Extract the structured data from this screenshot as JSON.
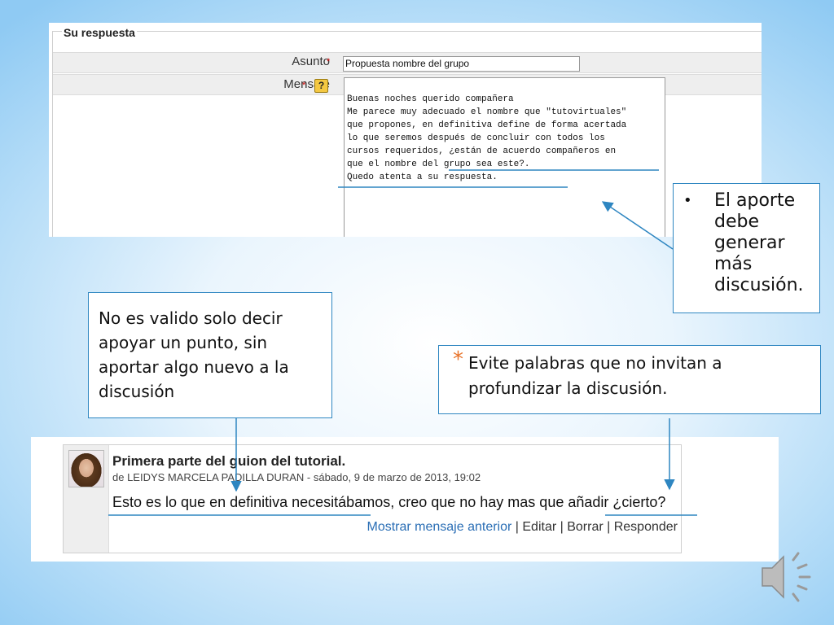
{
  "form": {
    "legend": "Su respuesta",
    "asunto_label": "Asunto",
    "mensaje_label": "Mensaje",
    "required_mark": "*",
    "help_icon": "?",
    "asunto_value": "Propuesta nombre del grupo",
    "mensaje_lines": [
      "Buenas noches querido compañera",
      "",
      "Me parece muy adecuado el nombre que \"tutovirtuales\"",
      "que propones, en definitiva define de forma acertada",
      "lo que seremos después de concluir con todos los",
      "cursos requeridos, ¿están de acuerdo compañeros en",
      "que el nombre del grupo sea este?.",
      "",
      "Quedo atenta a su respuesta."
    ]
  },
  "callouts": {
    "aporte_bullet": "•",
    "aporte_text": "El aporte debe generar más discusión.",
    "valido_text": "No es valido solo decir apoyar un punto, sin aportar algo nuevo a la discusión",
    "evite_star": "*",
    "evite_text": "Evite palabras  que no invitan a profundizar la discusión."
  },
  "forum": {
    "title": "Primera parte del guion del tutorial.",
    "meta": "de LEIDYS MARCELA PADILLA DURAN - sábado, 9 de marzo de 2013, 19:02",
    "body": "Esto es lo que en definitiva necesitábamos, creo que no hay mas que añadir ¿cierto?",
    "action_show_prev": "Mostrar mensaje anterior",
    "action_sep": " | ",
    "action_edit": "Editar",
    "action_delete": "Borrar",
    "action_reply": "Responder"
  },
  "colors": {
    "callout_border": "#2e86c1",
    "arrow": "#2e86c1",
    "star": "#e8732a",
    "link": "#2a6eb5"
  },
  "icons": {
    "speaker": "speaker-icon"
  }
}
